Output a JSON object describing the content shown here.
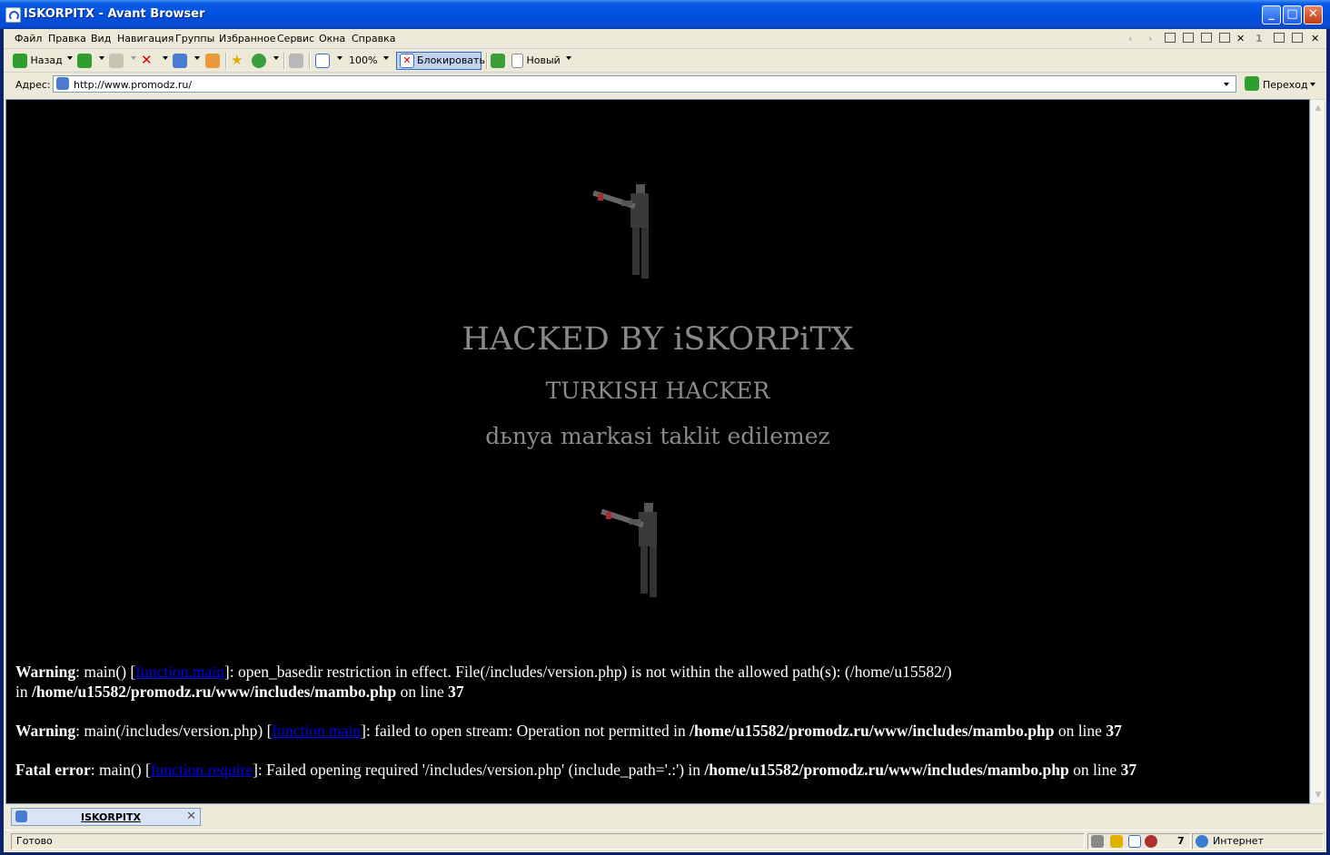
{
  "window": {
    "title": "ISKORPITX - Avant Browser"
  },
  "window_controls": {
    "minimize": "_",
    "maximize": "□",
    "close": "✕"
  },
  "menu": [
    "Файл",
    "Правка",
    "Вид",
    "Навигация",
    "Группы",
    "Избранное",
    "Сервис",
    "Окна",
    "Справка"
  ],
  "mdi": {
    "page_number": "1"
  },
  "toolbar": {
    "back_label": "Назад",
    "zoom_value": "100%",
    "block_label": "Блокировать",
    "new_label": "Новый"
  },
  "address": {
    "label": "Адрес:",
    "url": "http://www.promodz.ru/",
    "go_label": "Переход"
  },
  "page": {
    "headline": "HACKED BY iSKORPiTX",
    "subtitle": "TURKISH HACKER",
    "tagline": "dьnya markasi taklit edilemez",
    "errors": [
      {
        "label": "Warning",
        "prefix": ": main() [",
        "link": "function.main",
        "message": "]: open_basedir restriction in effect. File(/includes/version.php) is not within the allowed path(s): (/home/u15582/)",
        "in_text": "in",
        "path": "/home/u15582/promodz.ru/www/includes/mambo.php",
        "line_text": "on line",
        "line": "37"
      },
      {
        "label": "Warning",
        "prefix": ": main(/includes/version.php) [",
        "link": "function.main",
        "message": "]: failed to open stream: Operation not permitted in",
        "path": "/home/u15582/promodz.ru/www/includes/mambo.php",
        "line_text": "on line",
        "line": "37"
      },
      {
        "label": "Fatal error",
        "prefix": ": main() [",
        "link": "function.require",
        "message": "]: Failed opening required '/includes/version.php' (include_path='.:') in",
        "path": "/home/u15582/promodz.ru/www/includes/mambo.php",
        "line_text": "on line",
        "line": "37"
      }
    ]
  },
  "tabs": [
    {
      "label": "ISKORPITX"
    }
  ],
  "status": {
    "text": "Готово",
    "count": "7",
    "zone": "Интернет"
  },
  "colors": {
    "titlebar": "#0050e0",
    "chrome": "#ece9d8",
    "page_bg": "#000000",
    "hack_text": "#8a8a8a",
    "link": "#0000ee"
  }
}
